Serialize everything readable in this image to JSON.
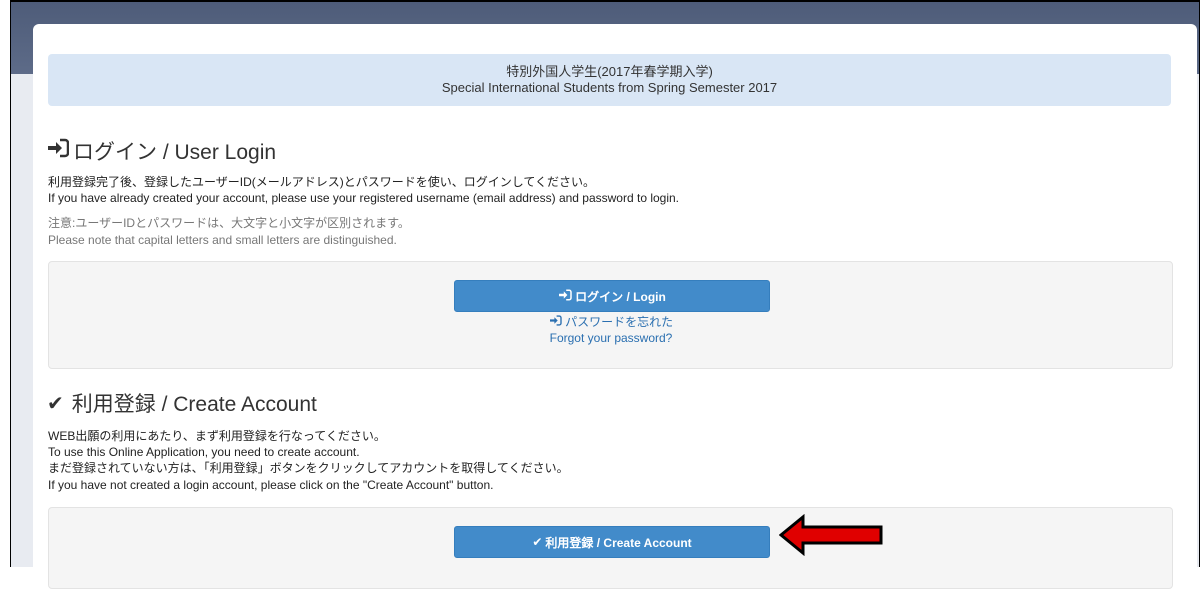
{
  "banner": {
    "line1": "特別外国人学生(2017年春学期入学)",
    "line2": "Special International Students from Spring Semester 2017"
  },
  "login": {
    "icon": "sign-in-icon",
    "title": "ログイン / User Login",
    "desc_ja": "利用登録完了後、登録したユーザーID(メールアドレス)とパスワードを使い、ログインしてください。",
    "desc_en": "If you have already created your account, please use your registered username (email address) and password to login.",
    "note_ja": "注意:ユーザーIDとパスワードは、大文字と小文字が区別されます。",
    "note_en": "Please note that capital letters and small letters are distinguished.",
    "button_label": "ログイン / Login",
    "forgot_ja": "パスワードを忘れた",
    "forgot_en": "Forgot your password?"
  },
  "create": {
    "icon": "check-icon",
    "title": "利用登録 / Create Account",
    "line1": "WEB出願の利用にあたり、まず利用登録を行なってください。",
    "line2": "To use this Online Application, you need to create account.",
    "line3": "まだ登録されていない方は、「利用登録」ボタンをクリックしてアカウントを取得してください。",
    "line4": "If you have not created a login account, please click on the \"Create Account\" button.",
    "button_label": "利用登録 / Create Account"
  },
  "colors": {
    "primary": "#428bca",
    "banner": "#d9e6f5",
    "arrow": "#e00000"
  }
}
